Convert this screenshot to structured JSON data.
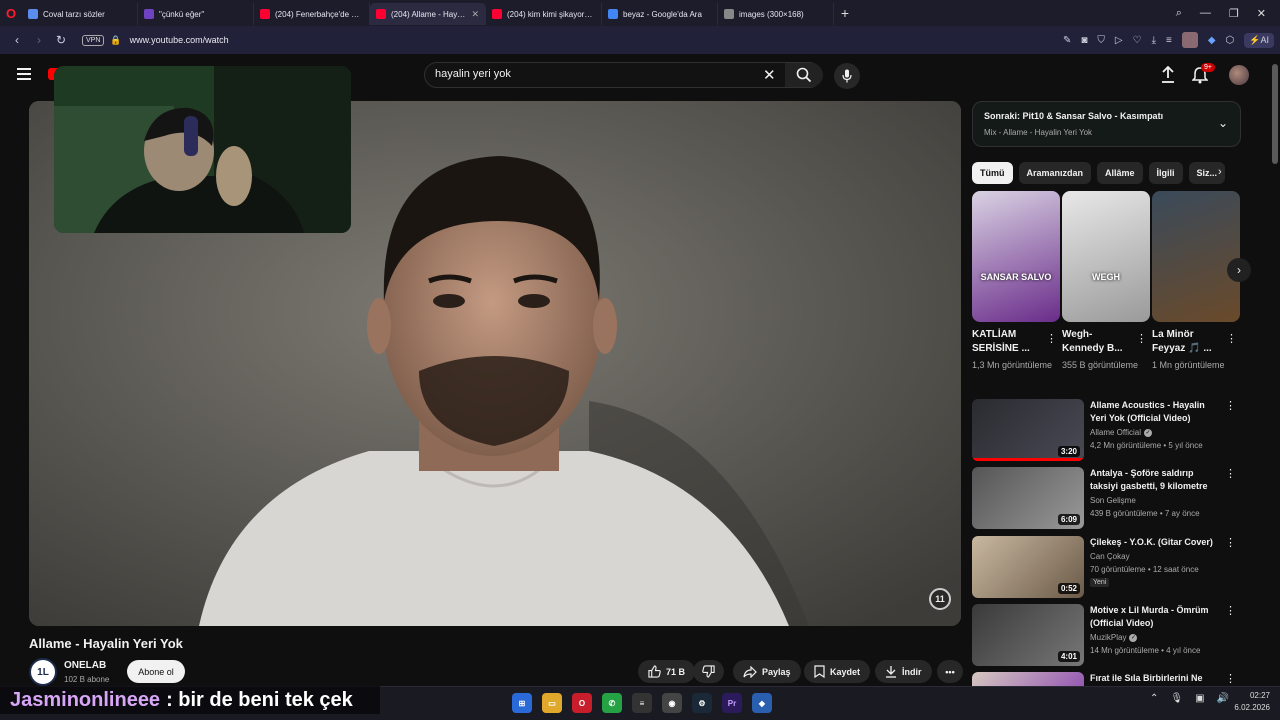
{
  "browser": {
    "tabs": [
      {
        "label": "Coval tarzı sözler",
        "color": "#5b8def"
      },
      {
        "label": "\"çünkü eğer\"",
        "color": "#6f42c1"
      },
      {
        "label": "(204) Fenerbahçe'de Kant...",
        "color": "#ff0033"
      },
      {
        "label": "(204) Allame - Hayalin...",
        "color": "#ff0033",
        "active": true
      },
      {
        "label": "(204) kim kimi şikayorsa si...",
        "color": "#ff0033"
      },
      {
        "label": "beyaz - Google'da Ara",
        "color": "#4285f4"
      },
      {
        "label": "images (300×168)",
        "color": "#888888"
      }
    ],
    "vpn_label": "VPN",
    "url": "www.youtube.com/watch",
    "ai_label": "AI"
  },
  "masthead": {
    "search_value": "hayalin yeri yok",
    "notif_count": "9+"
  },
  "video": {
    "title": "Allame - Hayalin Yeri Yok",
    "channel_name": "ONELAB",
    "channel_avatar_text": "1L",
    "subscribers": "102 B abone",
    "subscribe_label": "Abone ol",
    "like_count": "71 B",
    "share_label": "Paylaş",
    "save_label": "Kaydet",
    "download_label": "İndir"
  },
  "up_next": {
    "title": "Sonraki: Pit10 & Sansar Salvo - Kasımpatı",
    "subtitle": "Mix - Allame - Hayalin Yeri Yok"
  },
  "chips": [
    "Tümü",
    "Aramanızdan",
    "Allâme",
    "İlgili",
    "Siz..."
  ],
  "shelf": [
    {
      "title": "KATLİAM SERİSİNE ...",
      "views": "1,3 Mn görüntüleme",
      "caption": "SANSAR SALVO",
      "bg1": "#d9d2e3",
      "bg2": "#6a2c8a"
    },
    {
      "title": "Wegh-Kennedy B...",
      "views": "355 B görüntüleme",
      "caption": "WEGH",
      "bg1": "#e8e8e8",
      "bg2": "#9a9a9a"
    },
    {
      "title": "La Minör Feyyaz 🎵 ...",
      "views": "1 Mn görüntüleme",
      "caption": "",
      "bg1": "#3a4a5a",
      "bg2": "#6a4a2a"
    }
  ],
  "recommendations": [
    {
      "title": "Allame Acoustics - Hayalin Yeri Yok (Official Video)",
      "channel": "Allame Official",
      "verified": true,
      "meta": "4,2 Mn görüntüleme • 5 yıl önce",
      "duration": "3:20",
      "progress": 1.0,
      "bg1": "#2a2a30",
      "bg2": "#4a4a55"
    },
    {
      "title": "Antalya - Şoföre saldırıp taksiyi gasbetti, 9 kilometre sonra ka...",
      "channel": "Son Gelişme",
      "verified": false,
      "meta": "439 B görüntüleme • 7 ay önce",
      "duration": "6:09",
      "progress": 0,
      "bg1": "#555",
      "bg2": "#999"
    },
    {
      "title": "Çilekeş - Y.O.K. (Gitar Cover)",
      "channel": "Can Çokay",
      "verified": false,
      "meta": "70 görüntüleme • 12 saat önce",
      "badge": "Yeni",
      "duration": "0:52",
      "progress": 0,
      "bg1": "#c9b8a0",
      "bg2": "#6b5a48"
    },
    {
      "title": "Motive x Lil Murda - Ömrüm (Official Video)",
      "channel": "MuzikPlay",
      "verified": true,
      "meta": "14 Mn görüntüleme • 4 yıl önce",
      "duration": "4:01",
      "progress": 0,
      "bg1": "#3a3a3a",
      "bg2": "#777"
    },
    {
      "title": "Fırat ile Sıla Birbirlerini Ne",
      "channel": "",
      "verified": false,
      "meta": "",
      "duration": "",
      "progress": 0,
      "bg1": "#d6c8c0",
      "bg2": "#7d2fae"
    }
  ],
  "chat": {
    "user": "Jasminonlineee",
    "message": ": bir de beni tek çek"
  },
  "taskbar": {
    "time": "02:27",
    "date": "6.02.2026"
  }
}
